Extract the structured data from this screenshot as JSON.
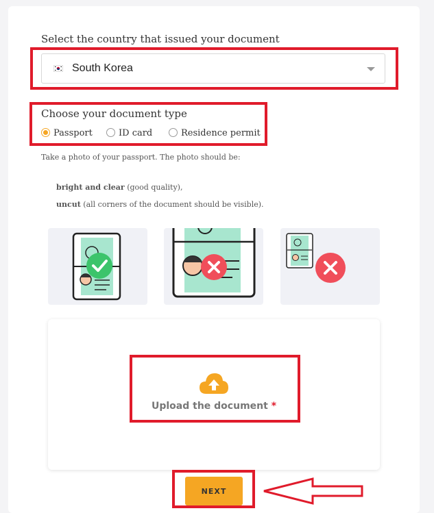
{
  "country": {
    "label": "Select the country that issued your document",
    "selected": "South Korea",
    "flag_icon": "south-korea-flag-icon"
  },
  "document_type": {
    "label": "Choose your document type",
    "options": [
      {
        "label": "Passport",
        "selected": true
      },
      {
        "label": "ID card",
        "selected": false
      },
      {
        "label": "Residence permit",
        "selected": false
      }
    ]
  },
  "instructions": {
    "intro": "Take a photo of your passport. The photo should be:",
    "item1_bold": "bright and clear",
    "item1_rest": " (good quality),",
    "item2_bold": "uncut",
    "item2_rest": " (all corners of the document should be visible)."
  },
  "examples": [
    {
      "name": "good-photo-example",
      "status": "check-icon"
    },
    {
      "name": "too-close-example",
      "status": "cross-icon"
    },
    {
      "name": "too-far-example",
      "status": "cross-icon"
    }
  ],
  "upload": {
    "label": "Upload the document",
    "required_mark": "*",
    "icon": "cloud-upload-icon"
  },
  "next_button": "NEXT",
  "colors": {
    "accent": "#f5a623",
    "highlight": "#e01b2b",
    "success": "#3cc46b",
    "error": "#f04e5a"
  }
}
